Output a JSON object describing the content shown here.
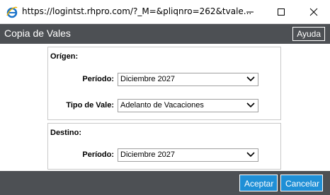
{
  "window": {
    "url_title": "https://logintst.rhpro.com/?_M=&pliqnro=262&tvale..."
  },
  "header": {
    "title": "Copia de Vales",
    "help_label": "Ayuda"
  },
  "origen": {
    "title": "Orígen:",
    "periodo_label": "Período:",
    "periodo_value": "Diciembre 2027",
    "tipo_label": "Tipo de Vale:",
    "tipo_value": "Adelanto de Vacaciones"
  },
  "destino": {
    "title": "Destino:",
    "periodo_label": "Período:",
    "periodo_value": "Diciembre 2027"
  },
  "footer": {
    "accept_label": "Aceptar",
    "cancel_label": "Cancelar"
  },
  "colors": {
    "header_bg": "#4d5054",
    "button_blue": "#1f8fd6"
  }
}
